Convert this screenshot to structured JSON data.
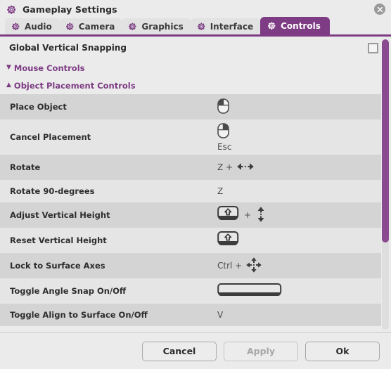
{
  "window": {
    "title": "Gameplay Settings",
    "title_icon": "gear-icon",
    "close_icon": "close-icon",
    "accent_color": "#7d3c84"
  },
  "tabs": [
    {
      "label": "Audio",
      "icon": "gear-icon",
      "active": false
    },
    {
      "label": "Camera",
      "icon": "gear-icon",
      "active": false
    },
    {
      "label": "Graphics",
      "icon": "gear-icon",
      "active": false
    },
    {
      "label": "Interface",
      "icon": "gear-icon",
      "active": false
    },
    {
      "label": "Controls",
      "icon": "gear-icon",
      "active": true
    }
  ],
  "global_option": {
    "label": "Global Vertical Snapping",
    "checked": false
  },
  "sections": [
    {
      "label": "Mouse Controls",
      "expanded": false,
      "triangle": "▼"
    },
    {
      "label": "Object Placement Controls",
      "expanded": true,
      "triangle": "▲"
    }
  ],
  "bindings": [
    {
      "name": "Place Object",
      "binding": "",
      "sub": "",
      "icon": "mouse-left-click-icon",
      "shaded": true
    },
    {
      "name": "Cancel Placement",
      "binding": "",
      "sub": "Esc",
      "icon": "mouse-right-click-icon",
      "shaded": false
    },
    {
      "name": "Rotate",
      "binding": "Z +",
      "sub": "",
      "icon": "left-right-arrow-icon",
      "shaded": true
    },
    {
      "name": "Rotate 90-degrees",
      "binding": "Z",
      "sub": "",
      "icon": "",
      "shaded": false
    },
    {
      "name": "Adjust Vertical Height",
      "binding": "+",
      "sub": "",
      "icon": "shift-key-icon+up-down-arrow-icon",
      "shaded": true
    },
    {
      "name": "Reset Vertical Height",
      "binding": "",
      "sub": "",
      "icon": "shift-key-icon",
      "shaded": false
    },
    {
      "name": "Lock to Surface Axes",
      "binding": "Ctrl +",
      "sub": "",
      "icon": "four-way-arrow-icon",
      "shaded": true
    },
    {
      "name": "Toggle Angle Snap On/Off",
      "binding": "",
      "sub": "",
      "icon": "spacebar-key-icon",
      "shaded": false
    },
    {
      "name": "Toggle Align to Surface On/Off",
      "binding": "V",
      "sub": "",
      "icon": "",
      "shaded": true
    }
  ],
  "scrollbar": {
    "thumb_percent": 70
  },
  "footer": {
    "cancel_label": "Cancel",
    "apply_label": "Apply",
    "apply_disabled": true,
    "ok_label": "Ok"
  }
}
